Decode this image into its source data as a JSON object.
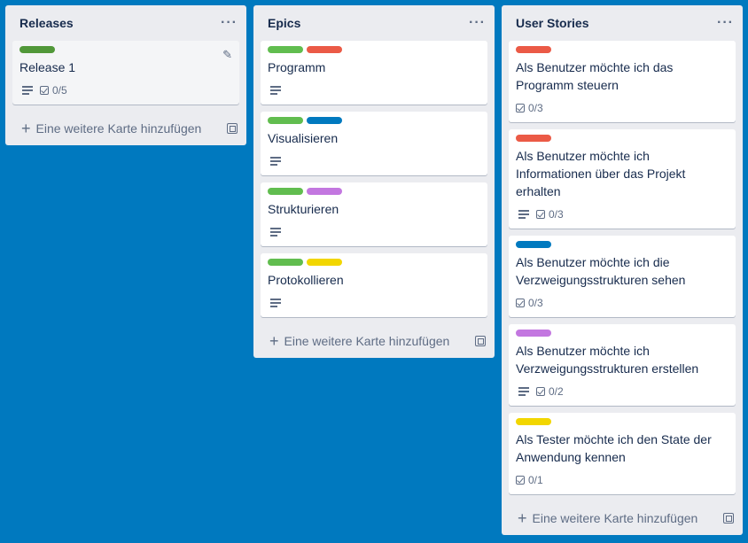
{
  "colors": {
    "green": "#61bd4f",
    "green_dark": "#519839",
    "red": "#eb5a46",
    "blue": "#0079bf",
    "purple": "#c377e0",
    "yellow": "#f2d600"
  },
  "lists": [
    {
      "title": "Releases",
      "add_label": "Eine weitere Karte hinzufügen",
      "cards": [
        {
          "title": "Release 1",
          "labels": [
            "green_dark"
          ],
          "description": true,
          "checklist": "0/5",
          "editing": true
        }
      ]
    },
    {
      "title": "Epics",
      "add_label": "Eine weitere Karte hinzufügen",
      "cards": [
        {
          "title": "Programm",
          "labels": [
            "green",
            "red"
          ],
          "description": true,
          "checklist": null
        },
        {
          "title": "Visualisieren",
          "labels": [
            "green",
            "blue"
          ],
          "description": true,
          "checklist": null
        },
        {
          "title": "Strukturieren",
          "labels": [
            "green",
            "purple"
          ],
          "description": true,
          "checklist": null
        },
        {
          "title": "Protokollieren",
          "labels": [
            "green",
            "yellow"
          ],
          "description": true,
          "checklist": null
        }
      ]
    },
    {
      "title": "User Stories",
      "add_label": "Eine weitere Karte hinzufügen",
      "cards": [
        {
          "title": "Als Benutzer möchte ich das Programm steuern",
          "labels": [
            "red"
          ],
          "description": false,
          "checklist": "0/3"
        },
        {
          "title": "Als Benutzer möchte ich Informationen über das Projekt erhalten",
          "labels": [
            "red"
          ],
          "description": true,
          "checklist": "0/3"
        },
        {
          "title": "Als Benutzer möchte ich die Verzweigungsstrukturen sehen",
          "labels": [
            "blue"
          ],
          "description": false,
          "checklist": "0/3"
        },
        {
          "title": "Als Benutzer möchte ich Verzweigungsstrukturen erstellen",
          "labels": [
            "purple"
          ],
          "description": true,
          "checklist": "0/2"
        },
        {
          "title": "Als Tester möchte ich den State der Anwendung kennen",
          "labels": [
            "yellow"
          ],
          "description": false,
          "checklist": "0/1"
        }
      ]
    }
  ]
}
